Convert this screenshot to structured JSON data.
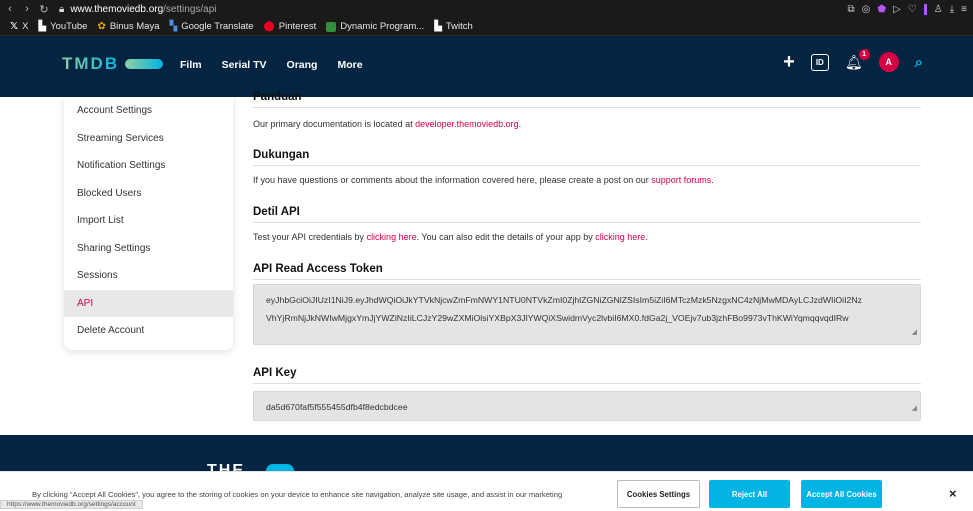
{
  "browser": {
    "url_host": "www.themoviedb.org",
    "url_path": "/settings/api",
    "bookmarks": [
      "X",
      "YouTube",
      "Binus Maya",
      "Google Translate",
      "Pinterest",
      "Dynamic Program...",
      "Twitch"
    ]
  },
  "header": {
    "logo": "TMDB",
    "nav": [
      "Film",
      "Serial TV",
      "Orang",
      "More"
    ],
    "lang_badge": "ID",
    "notification_count": "1",
    "avatar_initial": "A"
  },
  "sidebar": {
    "items": [
      "Account Settings",
      "Streaming Services",
      "Notification Settings",
      "Blocked Users",
      "Import List",
      "Sharing Settings",
      "Sessions",
      "API",
      "Delete Account"
    ]
  },
  "main": {
    "panduan": {
      "title": "Panduan",
      "text": "Our primary documentation is located at ",
      "link": "developer.themoviedb.org",
      "text_end": "."
    },
    "dukungan": {
      "title": "Dukungan",
      "text": "If you have questions or comments about the information covered here, please create a post on our ",
      "link": "support forums",
      "text_end": "."
    },
    "detil": {
      "title": "Detil API",
      "text1": "Test your API credentials by ",
      "link1": "clicking here",
      "text2": ". You can also edit the details of your app by ",
      "link2": "clicking here",
      "text_end": "."
    },
    "token": {
      "title": "API Read Access Token",
      "line1": "eyJhbGciOiJIUzI1NiJ9.eyJhdWQiOiJkYTVkNjcwZmFmNWY1NTU0NTVkZmI0ZjhlZGNiZGNlZSIsIm5iZiI6MTczMzk5NzgxNC4zNjMwMDAyLCJzdWIiOiI2Nz",
      "line2": "VhYjRmNjJkNWIwMjgxYmJjYWZiNzIiLCJzY29wZXMiOlsiYXBpX3JlYWQiXSwidmVyc2lvbiI6MX0.fdGa2j_VOEjv7ub3jzhFBo9973vThKWiYqmqqvqdIRw"
    },
    "apikey": {
      "title": "API Key",
      "value": "da5d670faf5f555455dfb4f8edcbdcee"
    }
  },
  "footer": {
    "logo_fragment": "THE"
  },
  "cookie": {
    "message": "By clicking “Accept All Cookies”, you agree to the storing of cookies on your device to enhance site navigation, analyze site usage, and assist in our marketing efforts.",
    "settings": "Cookies Settings",
    "reject": "Reject All",
    "accept": "Accept All Cookies",
    "close": "×"
  },
  "status_url": "https://www.themoviedb.org/settings/account"
}
